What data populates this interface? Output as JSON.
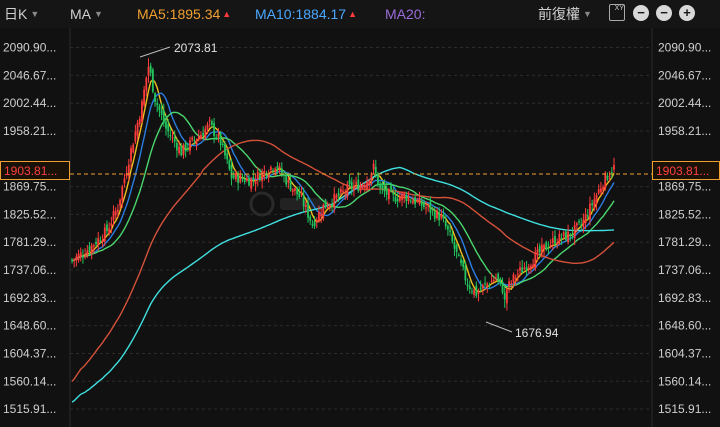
{
  "toolbar": {
    "period": "日K",
    "indicator": "MA",
    "ma5": "MA5:1895.34",
    "ma10": "MA10:1884.17",
    "ma20": "MA20:",
    "adjust": "前復權",
    "xy_icon": "XY"
  },
  "colors": {
    "up": "#ff3b3b",
    "down": "#22c55e",
    "ma5": "#f0c020",
    "ma10": "#2a7de1",
    "ma20": "#4ad66d",
    "ma60": "#d4513a",
    "ma120": "#40e0e0",
    "last": "#f0a030"
  },
  "axis": {
    "left": [
      "2090.90...",
      "2046.67...",
      "2002.44...",
      "1958.21...",
      "1869.75...",
      "1825.52...",
      "1781.29...",
      "1737.06...",
      "1692.83...",
      "1648.60...",
      "1604.37...",
      "1560.14...",
      "1515.91..."
    ],
    "right": [
      "2090.90...",
      "2046.67...",
      "2002.44...",
      "1958.21...",
      "1869.75...",
      "1825.52...",
      "1781.29...",
      "1737.06...",
      "1692.83...",
      "1648.60...",
      "1604.37...",
      "1560.14...",
      "1515.91..."
    ]
  },
  "last_price": {
    "left": "1903.81...",
    "right": "1903.81..."
  },
  "annotations": {
    "high": "2073.81",
    "low": "1676.94"
  }
}
